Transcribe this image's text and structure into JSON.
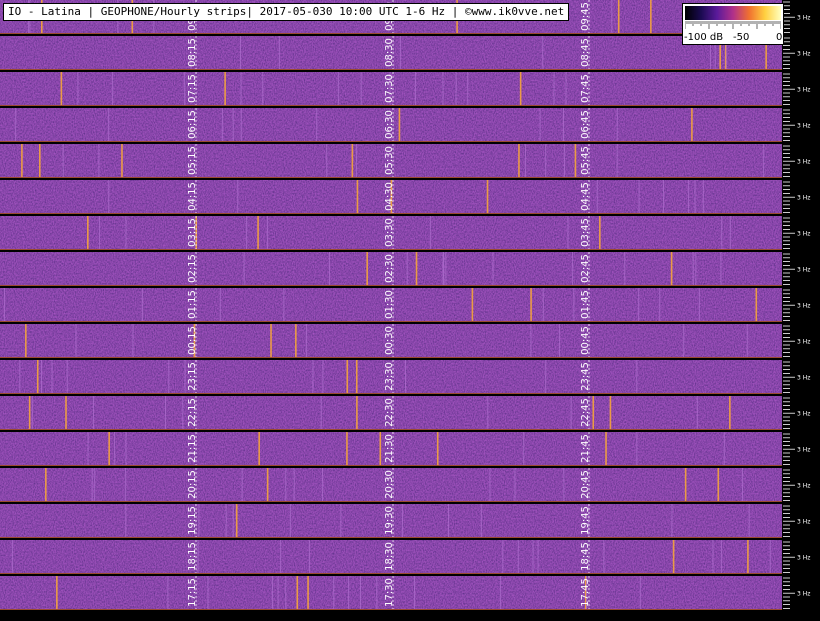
{
  "header": {
    "title": "IO - Latina | GEOPHONE/Hourly strips| 2017-05-030 10:00 UTC 1-6 Hz | ©www.ik0vve.net"
  },
  "color_scale": {
    "labels": [
      "-100 dB",
      "-50",
      "0"
    ],
    "gradient_colors": [
      "#000000",
      "#1a0a50",
      "#5a1a9a",
      "#b0308a",
      "#f07030",
      "#ffd040",
      "#ffffc0"
    ]
  },
  "colors": {
    "background": "#000000",
    "strip_base": "#2a1468",
    "strip_separator": "#9a4a30",
    "dashed_line": "#ffffff",
    "time_label": "#ffffff"
  },
  "frequency_label": "3 Hz",
  "strips": [
    {
      "labels": [
        "09:15",
        "09:30",
        "09:45"
      ]
    },
    {
      "labels": [
        "08:15",
        "08:30",
        "08:45"
      ]
    },
    {
      "labels": [
        "07:15",
        "07:30",
        "07:45"
      ]
    },
    {
      "labels": [
        "06:15",
        "06:30",
        "06:45"
      ]
    },
    {
      "labels": [
        "05:15",
        "05:30",
        "05:45"
      ]
    },
    {
      "labels": [
        "04:15",
        "04:30",
        "04:45"
      ]
    },
    {
      "labels": [
        "03:15",
        "03:30",
        "03:45"
      ]
    },
    {
      "labels": [
        "02:15",
        "02:30",
        "02:45"
      ]
    },
    {
      "labels": [
        "01:15",
        "01:30",
        "01:45"
      ]
    },
    {
      "labels": [
        "00:15",
        "00:30",
        "00:45"
      ]
    },
    {
      "labels": [
        "23:15",
        "23:30",
        "23:45"
      ]
    },
    {
      "labels": [
        "22:15",
        "22:30",
        "22:45"
      ]
    },
    {
      "labels": [
        "21:15",
        "21:30",
        "21:45"
      ]
    },
    {
      "labels": [
        "20:15",
        "20:30",
        "20:45"
      ]
    },
    {
      "labels": [
        "19:15",
        "19:30",
        "19:45"
      ]
    },
    {
      "labels": [
        "18:15",
        "18:30",
        "18:45"
      ]
    },
    {
      "labels": [
        "17:15",
        "17:30",
        "17:45"
      ]
    }
  ]
}
